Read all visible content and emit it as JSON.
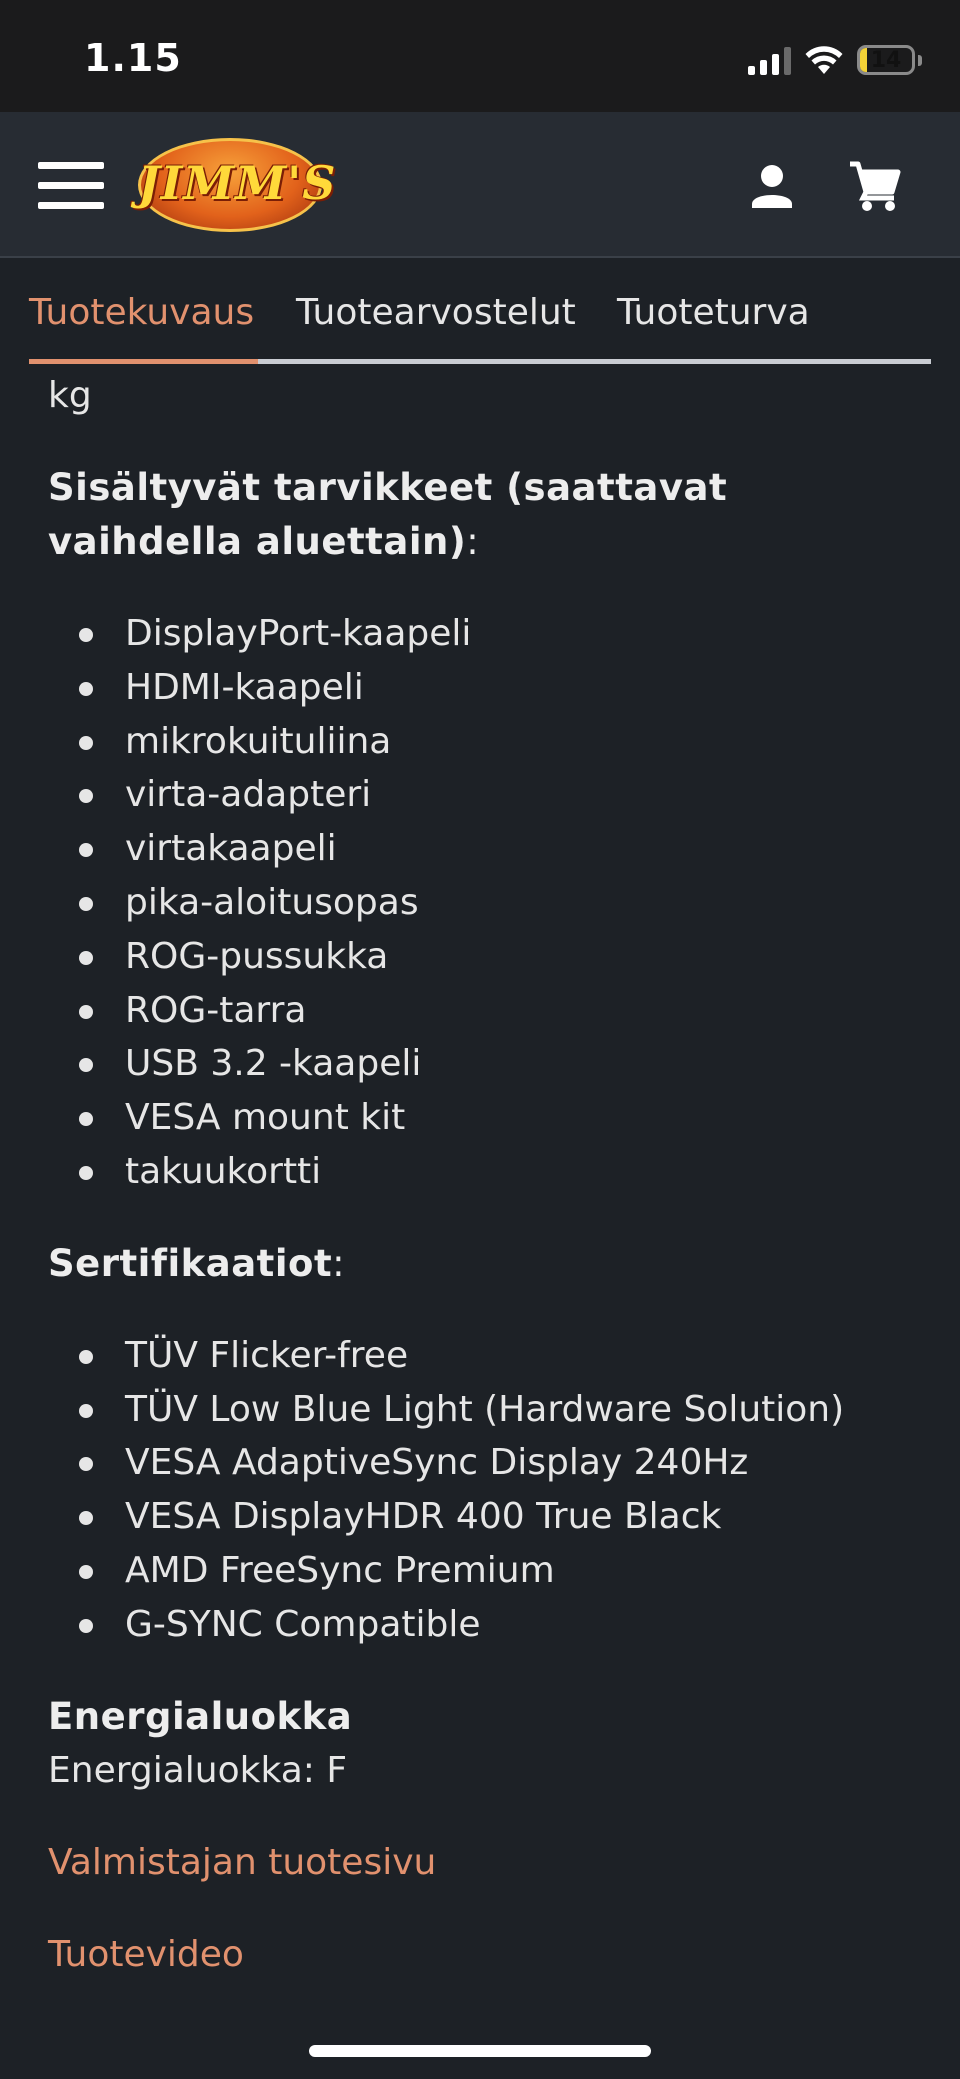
{
  "status_bar": {
    "time": "1.15",
    "battery_level": "14"
  },
  "header": {
    "logo_text": "JIMM'S",
    "menu_icon": "hamburger-menu-icon",
    "user_icon": "user-icon",
    "cart_icon": "cart-icon"
  },
  "tabs": [
    {
      "label": "Tuotekuvaus",
      "active": true
    },
    {
      "label": "Tuotearvostelut",
      "active": false
    },
    {
      "label": "Tuoteturva",
      "active": false
    }
  ],
  "content": {
    "prev_tail": "kg",
    "accessories_heading": "Sisältyvät tarvikkeet (saattavat vaihdella aluettain)",
    "colon": ":",
    "accessories": [
      "DisplayPort-kaapeli",
      "HDMI-kaapeli",
      "mikrokuituliina",
      "virta-adapteri",
      "virtakaapeli",
      "pika-aloitusopas",
      "ROG-pussukka",
      "ROG-tarra",
      "USB 3.2 -kaapeli",
      "VESA mount kit",
      "takuukortti"
    ],
    "certs_heading": "Sertifikaatiot",
    "certifications": [
      "TÜV Flicker-free",
      "TÜV Low Blue Light (Hardware Solution)",
      "VESA AdaptiveSync Display 240Hz",
      "VESA DisplayHDR 400 True Black",
      "AMD FreeSync Premium",
      "G-SYNC Compatible"
    ],
    "energy_heading": "Energialuokka",
    "energy_value": "Energialuokka: F",
    "manufacturer_link": "Valmistajan tuotesivu",
    "video_link": "Tuotevideo"
  },
  "colors": {
    "background": "#1d2126",
    "header": "#272c33",
    "accent": "#e1916e",
    "text": "#e6e6e6"
  }
}
